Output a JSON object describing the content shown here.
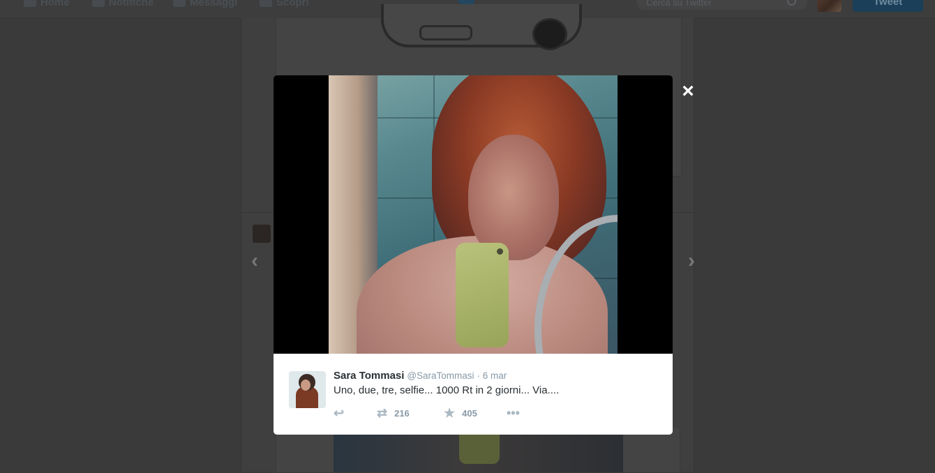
{
  "topbar": {
    "nav": [
      {
        "label": "Home",
        "icon": "home-icon"
      },
      {
        "label": "Notifiche",
        "icon": "notifications-icon"
      },
      {
        "label": "Messaggi",
        "icon": "messages-icon"
      },
      {
        "label": "Scopri",
        "icon": "hashtag-icon"
      }
    ],
    "search_placeholder": "Cerca su Twitter",
    "tweet_button": "Tweet"
  },
  "modal": {
    "close_icon": "×",
    "prev_icon": "‹",
    "next_icon": "›",
    "tweet": {
      "fullname": "Sara Tommasi",
      "username": "@SaraTommasi",
      "time": "· 6 mar",
      "text": "Uno, due, tre, selfie... 1000 Rt in 2 giorni... Via....",
      "retweets": "216",
      "favorites": "405"
    }
  },
  "colors": {
    "overlay": "#3a3a3a",
    "card_bg": "#ffffff",
    "name_text": "#292f33",
    "meta_text": "#8899a6"
  }
}
